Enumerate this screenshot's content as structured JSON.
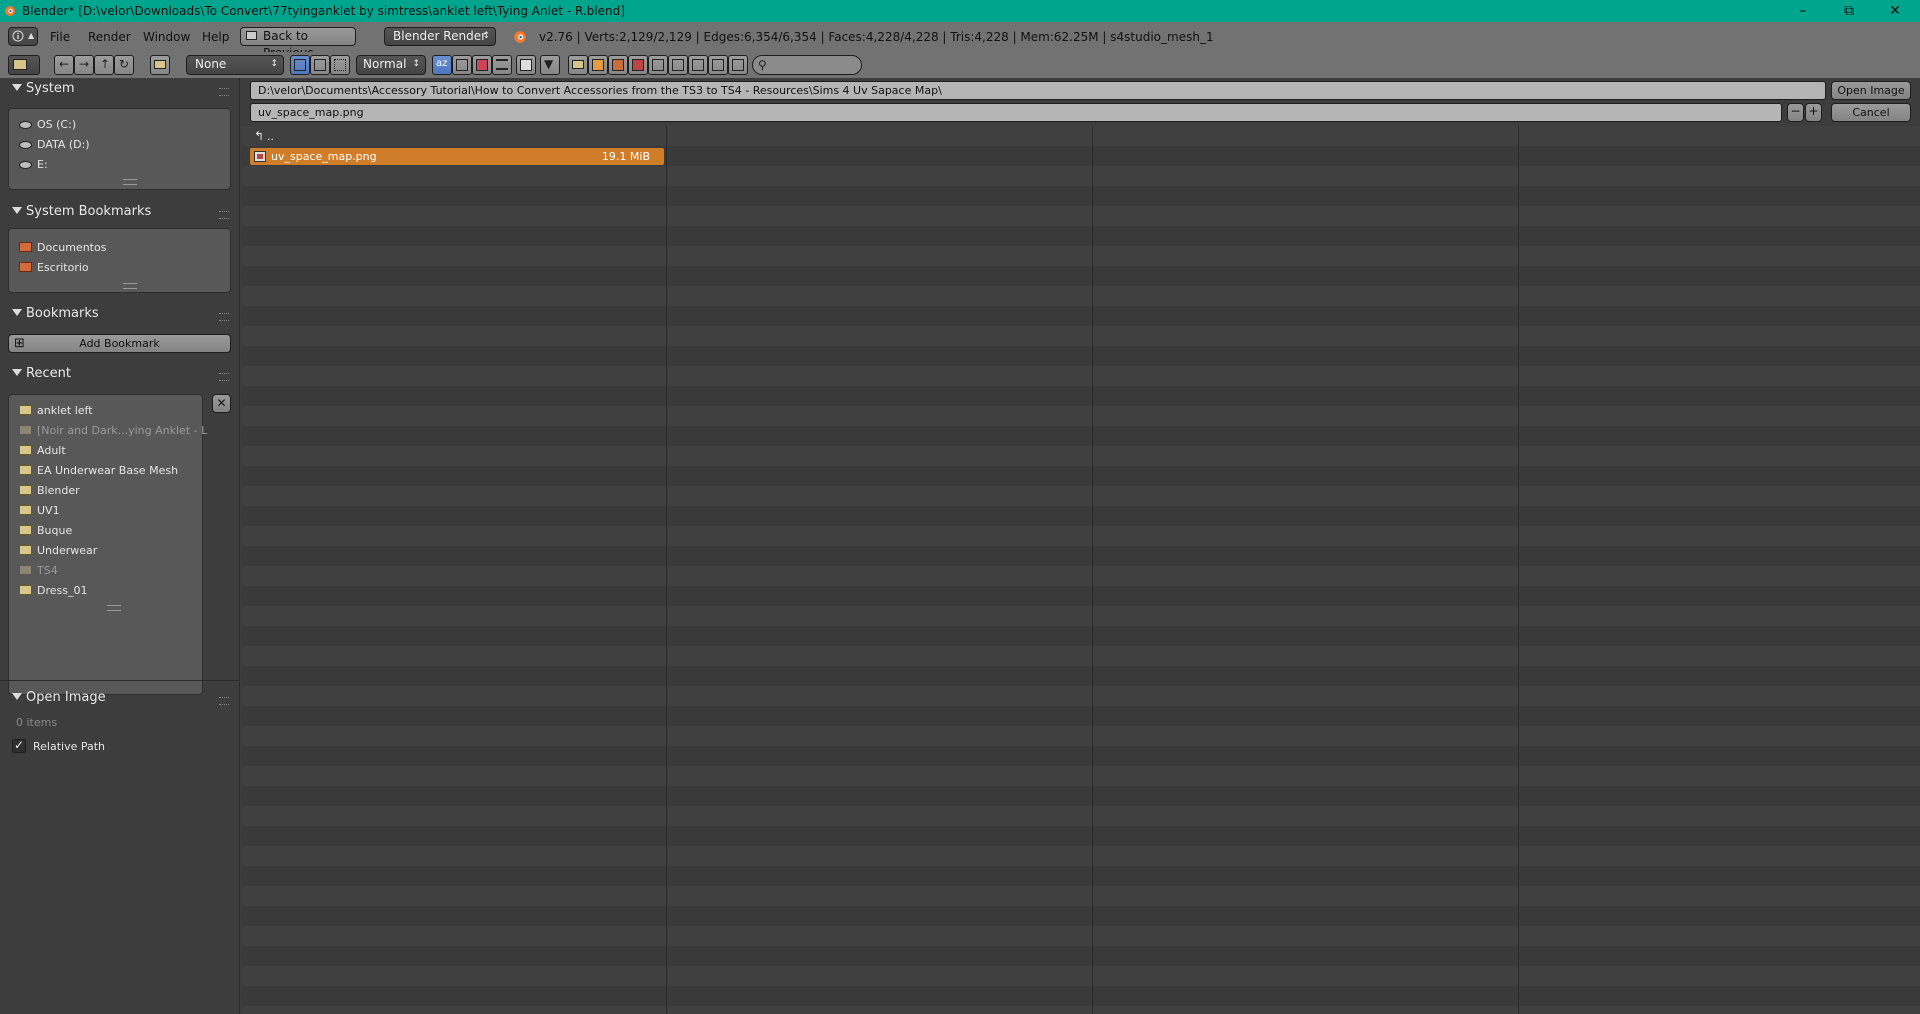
{
  "window": {
    "title": "Blender* [D:\\velor\\Downloads\\To Convert\\77tyinganklet by simtress\\anklet left\\Tying Anlet - R.blend]"
  },
  "menu": [
    "File",
    "Render",
    "Window",
    "Help"
  ],
  "header": {
    "back_button": "Back to Previous",
    "engine": "Blender Render",
    "stats": "v2.76 | Verts:2,129/2,129 | Edges:6,354/6,354 | Faces:4,228/4,228 | Tris:4,228 | Mem:62.25M | s4studio_mesh_1"
  },
  "toolbar": {
    "recent_dropdown": "None",
    "display_dropdown": "Normal",
    "search_placeholder": ""
  },
  "sidebar": {
    "system": {
      "title": "System",
      "items": [
        "OS (C:)",
        "DATA (D:)",
        "E:"
      ]
    },
    "system_bookmarks": {
      "title": "System Bookmarks",
      "items": [
        "Documentos",
        "Escritorio"
      ]
    },
    "bookmarks": {
      "title": "Bookmarks",
      "add_label": "Add Bookmark"
    },
    "recent": {
      "title": "Recent",
      "items": [
        {
          "label": "anklet left",
          "dim": false
        },
        {
          "label": "[Noir and Dark...ying Anklet - L",
          "dim": true
        },
        {
          "label": "Adult",
          "dim": false
        },
        {
          "label": "EA Underwear Base Mesh",
          "dim": false
        },
        {
          "label": "Blender",
          "dim": false
        },
        {
          "label": "UV1",
          "dim": false
        },
        {
          "label": "Buque",
          "dim": false
        },
        {
          "label": "Underwear",
          "dim": false
        },
        {
          "label": "TS4",
          "dim": true
        },
        {
          "label": "Dress_01",
          "dim": false
        }
      ]
    },
    "open_image": {
      "title": "Open Image",
      "items_count": "0 items",
      "relative_path_label": "Relative Path",
      "relative_path_checked": true
    }
  },
  "file_browser": {
    "directory": "D:\\velor\\Documents\\Accessory Tutorial\\How to Convert Accessories from the TS3 to TS4 - Resources\\Sims 4 Uv Sapace Map\\",
    "filename": "uv_space_map.png",
    "open_button": "Open Image",
    "cancel_button": "Cancel",
    "parent_label": "..",
    "files": [
      {
        "name": "uv_space_map.png",
        "size": "19.1 MiB",
        "selected": true
      }
    ]
  },
  "colors": {
    "titlebar": "#00a58e",
    "selection": "#d07d2a",
    "header": "#727272",
    "background": "#3d3d3d"
  }
}
